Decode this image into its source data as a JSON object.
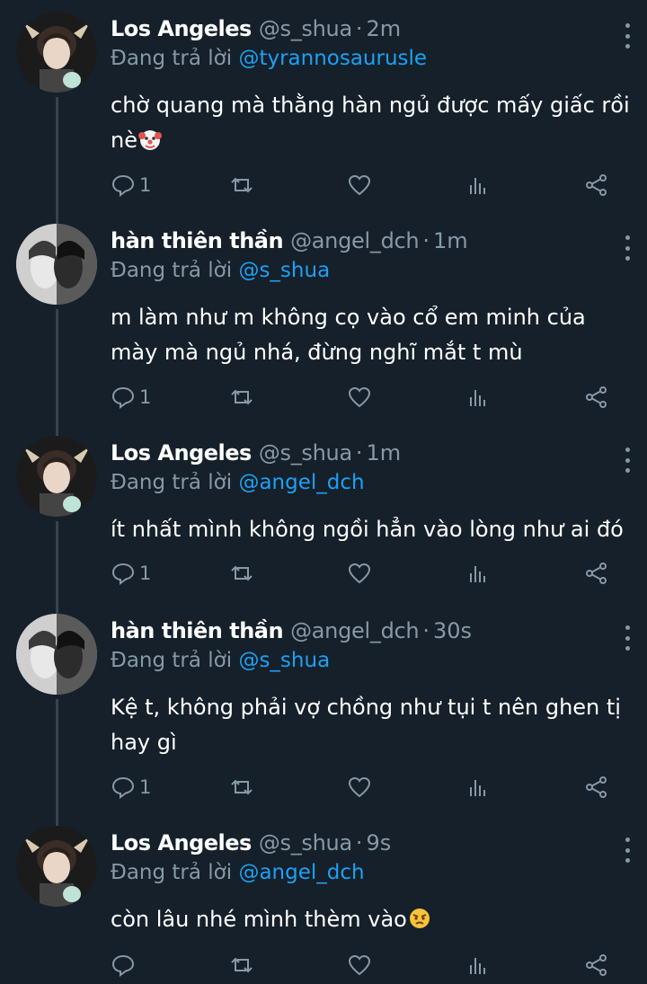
{
  "tweets": [
    {
      "name": "Los Angeles",
      "handle": "@s_shua",
      "time": "2m",
      "reply_prefix": "Đang trả lời",
      "reply_to": "@tyrannosaurusle",
      "text": "chờ quang mà thằng hàn ngủ được mấy giấc rồi nè",
      "emoji": "clown-face",
      "reply_count": "1",
      "avatar": "deer-ears-boy"
    },
    {
      "name": "hàn thiên thần",
      "handle": "@angel_dch",
      "time": "1m",
      "reply_prefix": "Đang trả lời",
      "reply_to": "@s_shua",
      "text": "m làm như m không cọ vào cổ em minh của mày mà ngủ nhá, đừng nghĩ mắt t mù",
      "emoji": "",
      "reply_count": "1",
      "avatar": "mirrored-portrait"
    },
    {
      "name": "Los Angeles",
      "handle": "@s_shua",
      "time": "1m",
      "reply_prefix": "Đang trả lời",
      "reply_to": "@angel_dch",
      "text": "ít nhất mình không ngồi hẳn vào lòng như ai đó",
      "emoji": "",
      "reply_count": "1",
      "avatar": "deer-ears-boy"
    },
    {
      "name": "hàn thiên thần",
      "handle": "@angel_dch",
      "time": "30s",
      "reply_prefix": "Đang trả lời",
      "reply_to": "@s_shua",
      "text": "Kệ t, không phải vợ chồng như tụi t nên ghen tị hay gì",
      "emoji": "",
      "reply_count": "1",
      "avatar": "mirrored-portrait"
    },
    {
      "name": "Los Angeles",
      "handle": "@s_shua",
      "time": "9s",
      "reply_prefix": "Đang trả lời",
      "reply_to": "@angel_dch",
      "text": "còn lâu nhé mình thèm vào",
      "emoji": "angry-face",
      "reply_count": "",
      "avatar": "deer-ears-boy"
    }
  ],
  "colors": {
    "background": "#15202b",
    "text_primary": "#ffffff",
    "text_secondary": "#8899a6",
    "link": "#1da1f2",
    "thread_line": "#38444d"
  }
}
